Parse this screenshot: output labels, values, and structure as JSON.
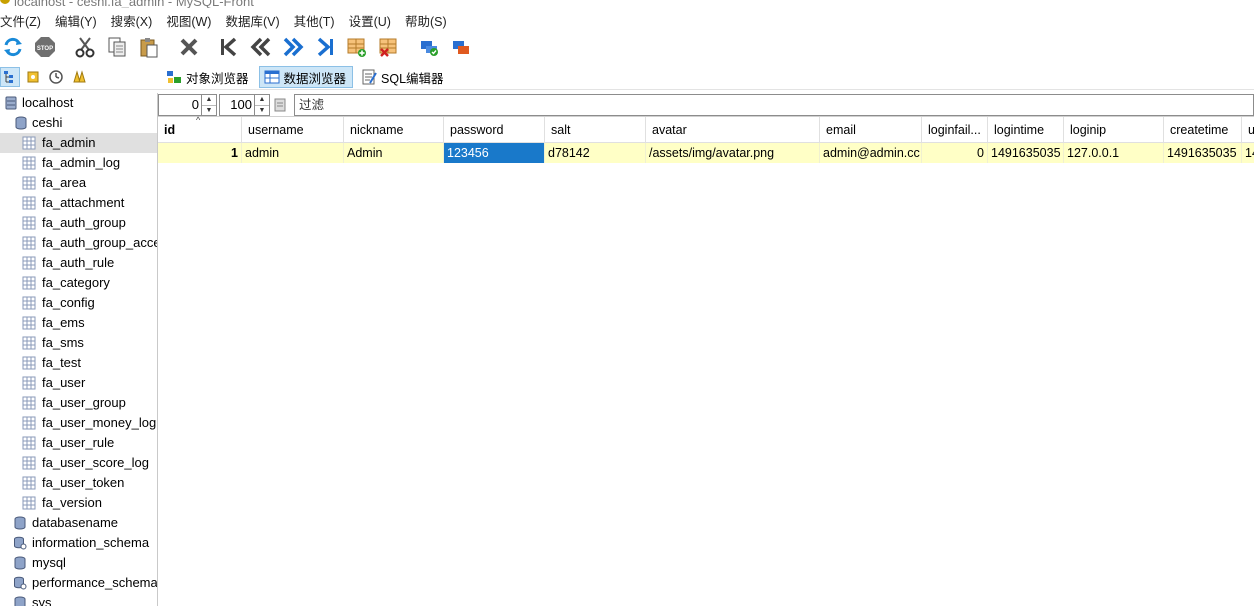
{
  "window": {
    "title": "localhost - ceshi.fa_admin - MySQL-Front"
  },
  "menu": [
    "文件(Z)",
    "编辑(Y)",
    "搜索(X)",
    "视图(W)",
    "数据库(V)",
    "其他(T)",
    "设置(U)",
    "帮助(S)"
  ],
  "toolbar": {
    "icons": [
      "refresh-icon",
      "stop-icon",
      "cut-icon",
      "copy-icon",
      "paste-icon",
      "delete-icon",
      "first-record-icon",
      "previous-page-icon",
      "next-page-icon",
      "last-record-icon",
      "insert-record-icon",
      "delete-record-icon",
      "post-record-icon",
      "cancel-record-icon"
    ]
  },
  "view_tabs": [
    {
      "label": "对象浏览器",
      "active": false
    },
    {
      "label": "数据浏览器",
      "active": true
    },
    {
      "label": "SQL编辑器",
      "active": false
    }
  ],
  "tree": {
    "server": "localhost",
    "database": "ceshi",
    "tables": [
      "fa_admin",
      "fa_admin_log",
      "fa_area",
      "fa_attachment",
      "fa_auth_group",
      "fa_auth_group_acce",
      "fa_auth_rule",
      "fa_category",
      "fa_config",
      "fa_ems",
      "fa_sms",
      "fa_test",
      "fa_user",
      "fa_user_group",
      "fa_user_money_log",
      "fa_user_rule",
      "fa_user_score_log",
      "fa_user_token",
      "fa_version"
    ],
    "selected_table": "fa_admin",
    "other_databases": [
      "databasename",
      "information_schema",
      "mysql",
      "performance_schema",
      "sys"
    ]
  },
  "navigation": {
    "offset": "0",
    "limit": "100",
    "filter_placeholder": "过滤"
  },
  "grid": {
    "columns": [
      "id",
      "username",
      "nickname",
      "password",
      "salt",
      "avatar",
      "email",
      "loginfail...",
      "logintime",
      "loginip",
      "createtime",
      "u"
    ],
    "rows": [
      [
        "1",
        "admin",
        "Admin",
        "123456",
        "d78142",
        "/assets/img/avatar.png",
        "admin@admin.cc",
        "0",
        "1491635035",
        "127.0.0.1",
        "1491635035",
        "14"
      ]
    ],
    "selected_cell": "password"
  }
}
